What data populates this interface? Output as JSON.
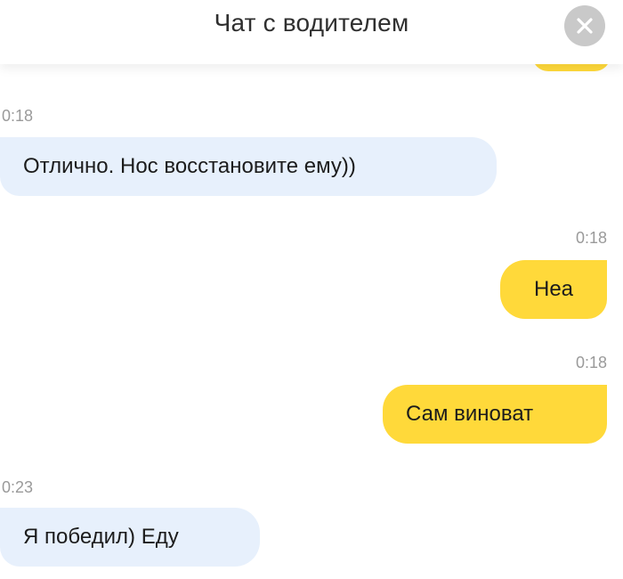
{
  "header": {
    "title": "Чат с водителем"
  },
  "messages": [
    {
      "time": "0:18",
      "text": "Отлично. Нос восстановите ему))",
      "direction": "incoming"
    },
    {
      "time": "0:18",
      "text": "Неа",
      "direction": "outgoing"
    },
    {
      "time": "0:18",
      "text": "Сам виноват",
      "direction": "outgoing"
    },
    {
      "time": "0:23",
      "text": "Я победил) Еду",
      "direction": "incoming"
    }
  ],
  "colors": {
    "incoming_bubble": "#e7f0fc",
    "outgoing_bubble": "#ffd93a",
    "close_button": "#c9c9c9"
  }
}
